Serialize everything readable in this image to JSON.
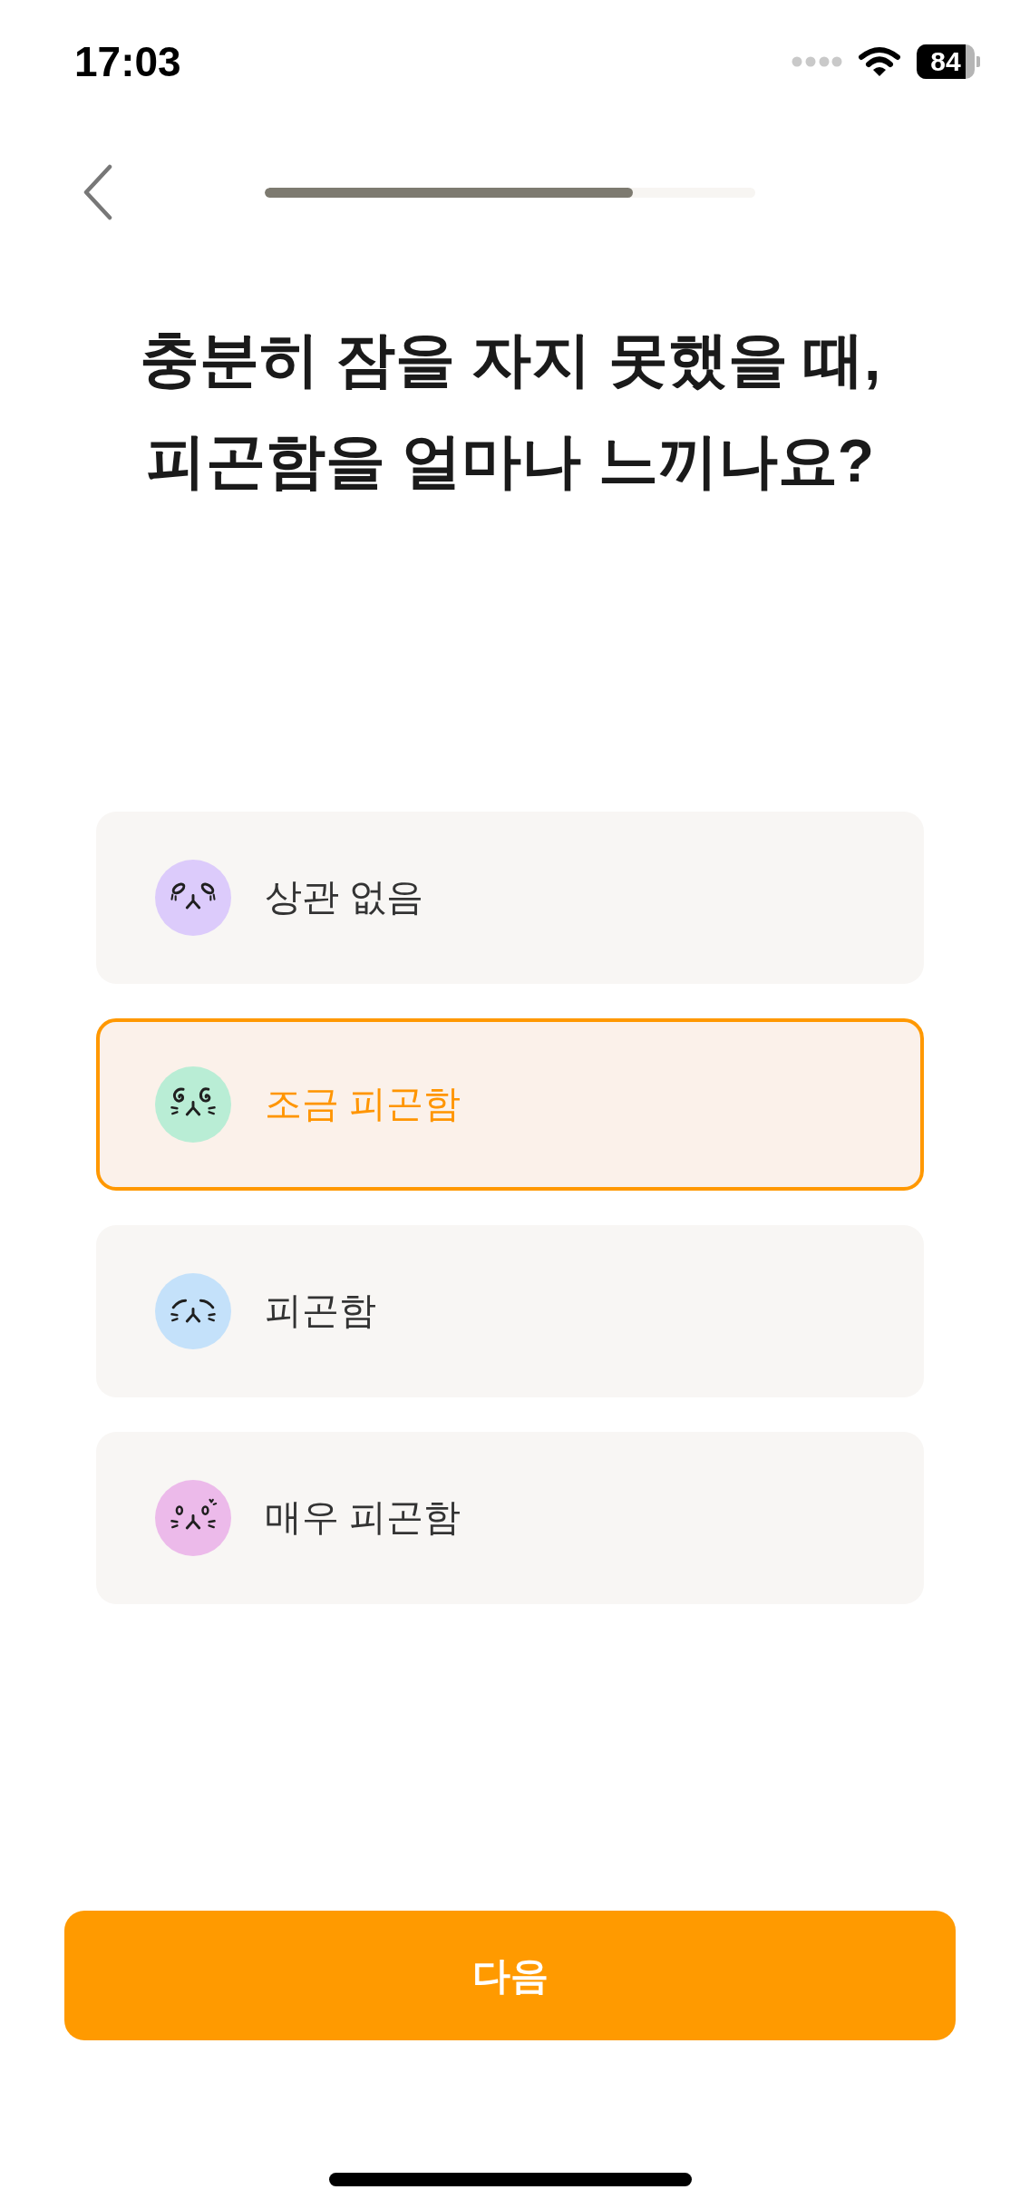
{
  "status_bar": {
    "time": "17:03",
    "battery": "84"
  },
  "header": {
    "progress": {
      "level": 0.75
    }
  },
  "question": {
    "text": "충분히 잠을 자지 못했을 때,\n피곤함을 얼마나 느끼나요?"
  },
  "options": [
    {
      "label": "상관 없음",
      "color": "#dccbfb",
      "selected": false
    },
    {
      "label": "조금 피곤함",
      "color": "#b9edd5",
      "selected": true
    },
    {
      "label": "피곤함",
      "color": "#c4e1fa",
      "selected": false
    },
    {
      "label": "매우 피곤함",
      "color": "#ecbaea",
      "selected": false
    }
  ],
  "next_button": {
    "label": "다음"
  }
}
